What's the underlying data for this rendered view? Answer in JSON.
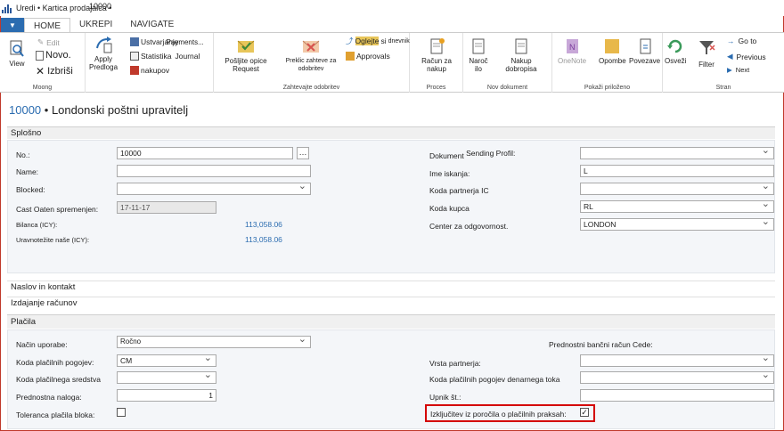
{
  "window": {
    "title": "Uredi • Kartica prodajalca •",
    "overlay_text": "10000"
  },
  "tabs": [
    {
      "label": "HOME"
    },
    {
      "label": "UKREPI"
    },
    {
      "label": "NAVIGATE"
    }
  ],
  "app_button": {
    "icon": "chevron-down-icon"
  },
  "ribbon": {
    "groups": {
      "moong": "Moong",
      "approvals": "Zahtevajte odobritev",
      "proces": "Proces",
      "nov_dokument": "Nov dokument",
      "prilozeno": "Pokaži priloženo",
      "stran": "Stran"
    },
    "view": "View",
    "edit": "Edit",
    "novo": "Novo.",
    "izbrisi": "Izbriši",
    "apply": "Apply",
    "predloga": "Predloga",
    "ustvarjanje": "Ustvarjanje",
    "payments": "Payments...",
    "statistika": "Statistika",
    "journal": "Journal",
    "nakupov": "nakupov",
    "send_approval": "Pošljite opice Request",
    "cancel_approval": "Preklic zahteve za odobritev",
    "oglejte": "Oglejte",
    "si": "si",
    "dnevnik": "dnevnik",
    "approvals": "Approvals",
    "racun_za_nakup": "Račun za nakup",
    "narocilo": "Naroč ilo",
    "nakup_dobropisa": "Nakup dobropisa",
    "onenote": "OneNote",
    "opombe": "Opombe",
    "povezave": "Povezave",
    "osvezi": "Osveži",
    "filter": "Filter",
    "goto": "Go to",
    "previous": "Previous",
    "next": "Next"
  },
  "page": {
    "number": "10000",
    "separator": " • ",
    "name": "Londonski poštni upravitelj"
  },
  "splosno": {
    "header": "Splošno",
    "no_label": "No.:",
    "no_value": "10000",
    "name_label": "Name:",
    "name_value": "",
    "blocked_label": "Blocked:",
    "blocked_value": "",
    "last_date_label": "Cast Oaten spremenjen:",
    "last_date_value": "17-11-17",
    "bilanca_label": "Bilanca (ICY):",
    "bilanca_value": "113,058.06",
    "uravnotezite_label": "Uravnotežite naše (ICY):",
    "uravnotezite_value": "113,058.06",
    "doc_profile_label": "Dokument",
    "doc_profile_label2": "Sending Profil:",
    "doc_profile_value": "",
    "ime_iskanja_label": "Ime iskanja:",
    "ime_iskanja_value": "L",
    "partner_ic_label": "Koda partnerja IC",
    "partner_ic_value": "",
    "koda_kupca_label": "Koda kupca",
    "koda_kupca_value": "RL",
    "center_label": "Center za odgovornost.",
    "center_value": "LONDON"
  },
  "naslov": {
    "header": "Naslov in kontakt"
  },
  "izdajanje": {
    "header": "Izdajanje računov"
  },
  "placila": {
    "header": "Plačila",
    "nacin_label": "Način uporabe:",
    "nacin_value": "Ročno",
    "koda_pogojev_label": "Koda plačilnih pogojev:",
    "koda_pogojev_value": "CM",
    "koda_sredstva_label": "Koda plačilnega sredstva",
    "koda_sredstva_value": "",
    "prednostna_label": "Prednostna naloga:",
    "prednostna_value": "1",
    "toleranca_label": "Toleranca plačila bloka:",
    "toleranca_checked": false,
    "bancni_label": "Prednostni bančni račun Cede:",
    "bancni_value": "",
    "vrsta_label": "Vrsta partnerja:",
    "vrsta_value": "",
    "denarnega_label": "Koda plačilnih pogojev denarnega toka",
    "denarnega_value": "",
    "upnik_label": "Upnik št.:",
    "upnik_value": "",
    "izkljucitev_label": "Izključitev iz poročila o plačilnih praksah:",
    "izkljucitev_checked": true
  },
  "colors": {
    "accent": "#2b6cb0",
    "highlight": "#d40000"
  }
}
